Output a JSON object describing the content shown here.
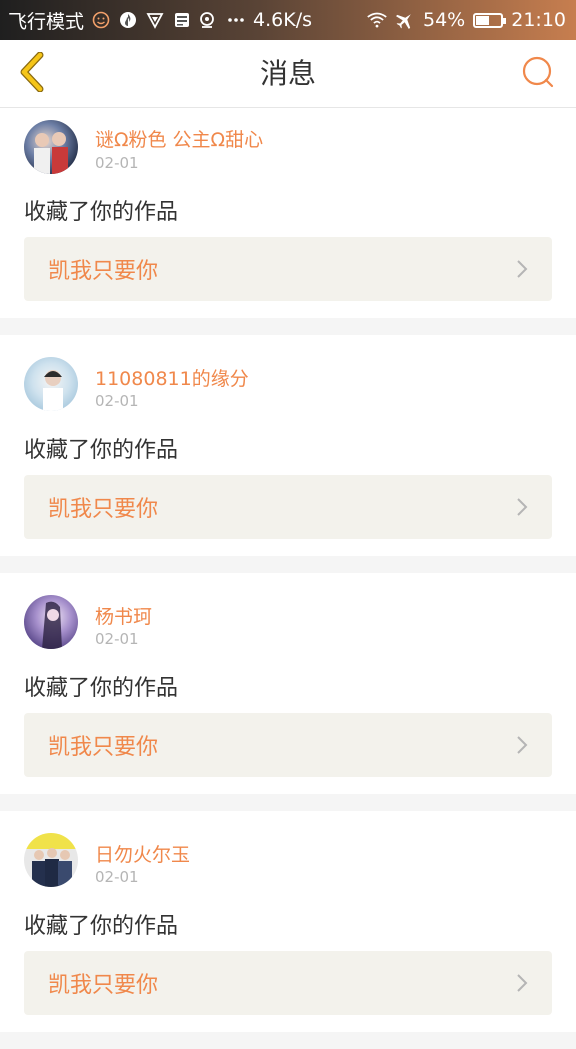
{
  "statusbar": {
    "mode_label": "飞行模式",
    "speed": "4.6K/s",
    "battery_text": "54%",
    "battery_level": 0.54,
    "time": "21:10",
    "icons": [
      "smile-icon",
      "fire-icon",
      "shield-icon",
      "storage-icon",
      "radar-icon",
      "more-dots-icon",
      "wifi-icon",
      "airplane-icon",
      "battery-icon"
    ]
  },
  "header": {
    "title": "消息",
    "back_icon": "chevron-left-icon",
    "search_icon": "search-icon"
  },
  "colors": {
    "accent": "#f0884b",
    "back_arrow": "#f5c518"
  },
  "messages": [
    {
      "user": "谜Ω粉色 公主Ω甜心",
      "date": "02-01",
      "action": "收藏了你的作品",
      "work": "凯我只要你"
    },
    {
      "user": "11080811的缘分",
      "date": "02-01",
      "action": "收藏了你的作品",
      "work": "凯我只要你"
    },
    {
      "user": "杨书珂",
      "date": "02-01",
      "action": "收藏了你的作品",
      "work": "凯我只要你"
    },
    {
      "user": "日勿火尔玉",
      "date": "02-01",
      "action": "收藏了你的作品",
      "work": "凯我只要你"
    }
  ]
}
